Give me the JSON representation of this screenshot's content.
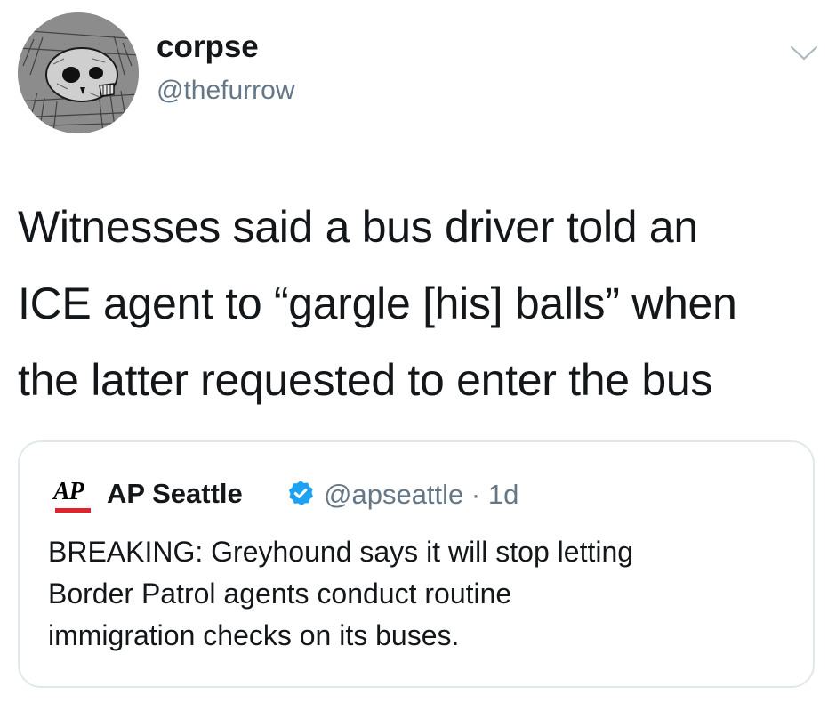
{
  "tweet": {
    "author": {
      "display_name": "corpse",
      "handle": "@thefurrow",
      "avatar_icon": "skull-illustration-avatar"
    },
    "menu_icon": "chevron-down-icon",
    "text_lines": [
      "Witnesses said a bus driver told an",
      "ICE agent to “gargle [his] balls” when",
      "the latter requested to enter the bus"
    ]
  },
  "quoted_tweet": {
    "logo_text": "AP",
    "logo_bar_color": "#e0242b",
    "display_name": "AP Seattle",
    "verified": true,
    "verified_icon": "verified-badge-icon",
    "verified_color": "#1da1f2",
    "handle": "@apseattle",
    "separator": "·",
    "time": "1d",
    "text_lines": [
      "BREAKING: Greyhound says it will stop letting",
      "Border Patrol agents conduct routine",
      "immigration checks on its buses."
    ]
  },
  "colors": {
    "text": "#14171a",
    "secondary": "#657786",
    "card_border": "#e1e8ed"
  }
}
